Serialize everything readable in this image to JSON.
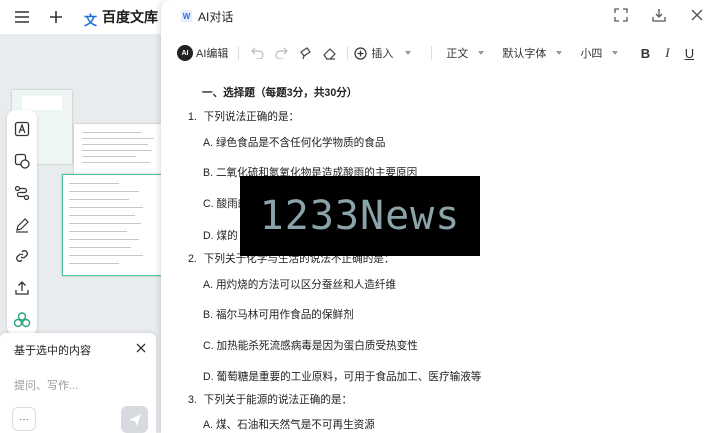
{
  "bg_app": {
    "brand": "百度文库"
  },
  "prompt": {
    "title": "基于选中的内容",
    "placeholder": "提问、写作...",
    "more": "···"
  },
  "modal": {
    "title": "AI对话",
    "toolbar": {
      "ai_edit": "AI编辑",
      "insert": "插入",
      "style": "正文",
      "font": "默认字体",
      "size": "小四",
      "bold": "B",
      "italic": "I",
      "underline": "U"
    }
  },
  "document": {
    "section_title": "一、选择题（每题3分，共30分）",
    "questions": [
      {
        "number": "1.",
        "text": "下列说法正确的是：",
        "options": [
          "A. 绿色食品是不含任何化学物质的食品",
          "B. 二氧化硫和氮氧化物是造成酸雨的主要原因",
          "C. 酸雨的",
          "D. 煤的"
        ]
      },
      {
        "number": "2.",
        "text": "下列关于化学与生活的说法不正确的是：",
        "options": [
          "A. 用灼烧的方法可以区分蚕丝和人造纤维",
          "B. 福尔马林可用作食品的保鲜剂",
          "C. 加热能杀死流感病毒是因为蛋白质受热变性",
          "D. 葡萄糖是重要的工业原料，可用于食品加工、医疗输液等"
        ]
      },
      {
        "number": "3.",
        "text": "下列关于能源的说法正确的是：",
        "options": [
          "A. 煤、石油和天然气是不可再生资源"
        ]
      }
    ]
  },
  "watermark": "1233News"
}
